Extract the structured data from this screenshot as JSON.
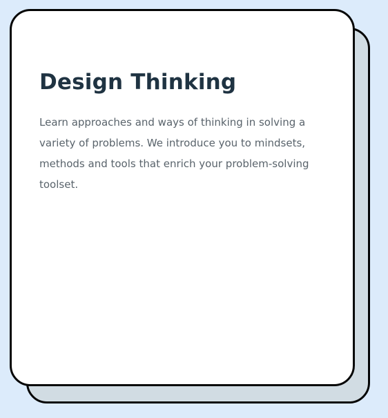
{
  "course_card": {
    "title": "Design Thinking",
    "description": "Learn approaches and ways of thinking in solving a variety of problems. We introduce you to mindsets, methods and tools that enrich your problem-solving toolset."
  }
}
